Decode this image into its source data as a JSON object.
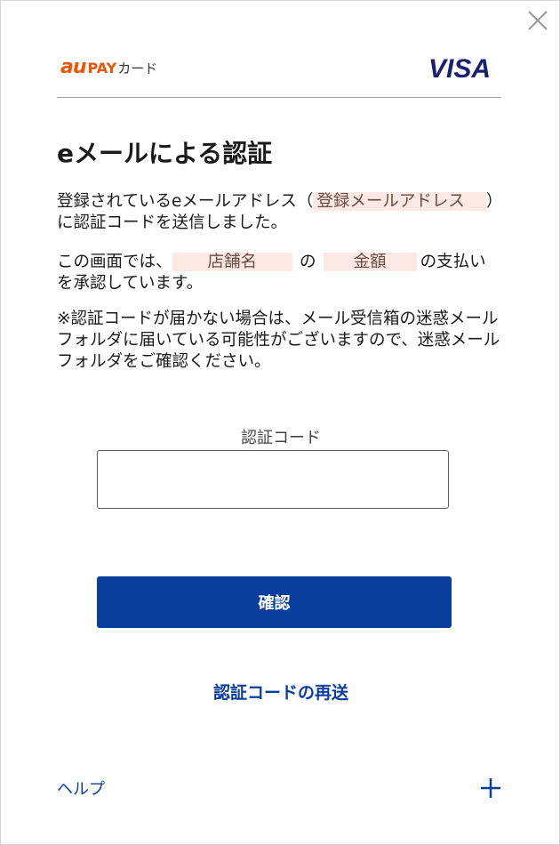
{
  "header": {
    "brand_au": "au",
    "brand_pay": "PAY",
    "brand_card": "カード",
    "network": "VISA"
  },
  "main": {
    "title": "eメールによる認証",
    "p1_before": "登録されているeメールアドレス（",
    "p1_email": "登録メールアドレス",
    "p1_after": "）に認証コードを送信しました。",
    "p2_before": "この画面では、",
    "p2_store": "店舗名",
    "p2_mid": "の",
    "p2_amount": "金額",
    "p2_after": "の支払いを承認しています。",
    "p3": "※認証コードが届かない場合は、メール受信箱の迷惑メールフォルダに届いている可能性がございますので、迷惑メールフォルダをご確認ください。",
    "code_label": "認証コード",
    "code_value": "",
    "confirm_label": "確認",
    "resend_label": "認証コードの再送"
  },
  "footer": {
    "help_label": "ヘルプ",
    "expand_icon": "plus-icon"
  },
  "colors": {
    "primary": "#0a3e9e",
    "au_orange": "#eb5505",
    "visa_navy": "#1a1f71",
    "highlight_bg": "#fde9e3"
  }
}
